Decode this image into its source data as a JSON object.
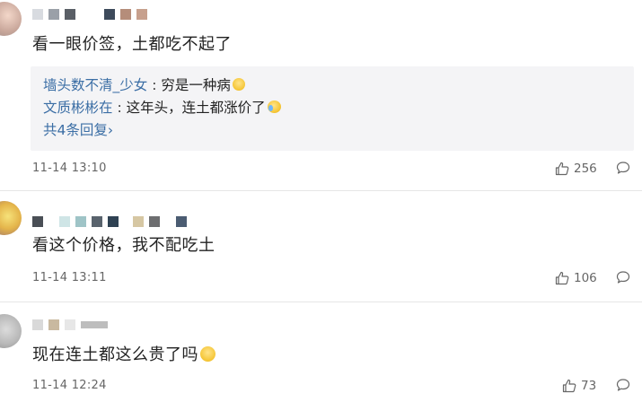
{
  "comments": [
    {
      "text": "看一眼价签，土都吃不起了",
      "replies": [
        {
          "user": "墙头数不清_少女",
          "separator": " : ",
          "text": "穷是一种病",
          "emoji": "smile-emoji"
        },
        {
          "user": "文质彬彬在",
          "separator": " : ",
          "text": "这年头，连土都涨价了",
          "emoji": "crying-laugh-emoji"
        }
      ],
      "more_replies": "共4条回复",
      "more_arrow": "›",
      "timestamp": "11-14 13:10",
      "likes": "256"
    },
    {
      "text": "看这个价格，我不配吃土",
      "timestamp": "11-14 13:11",
      "likes": "106"
    },
    {
      "text": "现在连土都这么贵了吗",
      "emoji": "smile-emoji",
      "timestamp": "11-14 12:24",
      "likes": "73"
    }
  ],
  "icons": {
    "like": "thumbs-up-icon",
    "reply": "comment-bubble-icon"
  },
  "colors": {
    "link": "#3b6ea5",
    "reply_bg": "#f4f4f6",
    "meta": "#666666"
  }
}
